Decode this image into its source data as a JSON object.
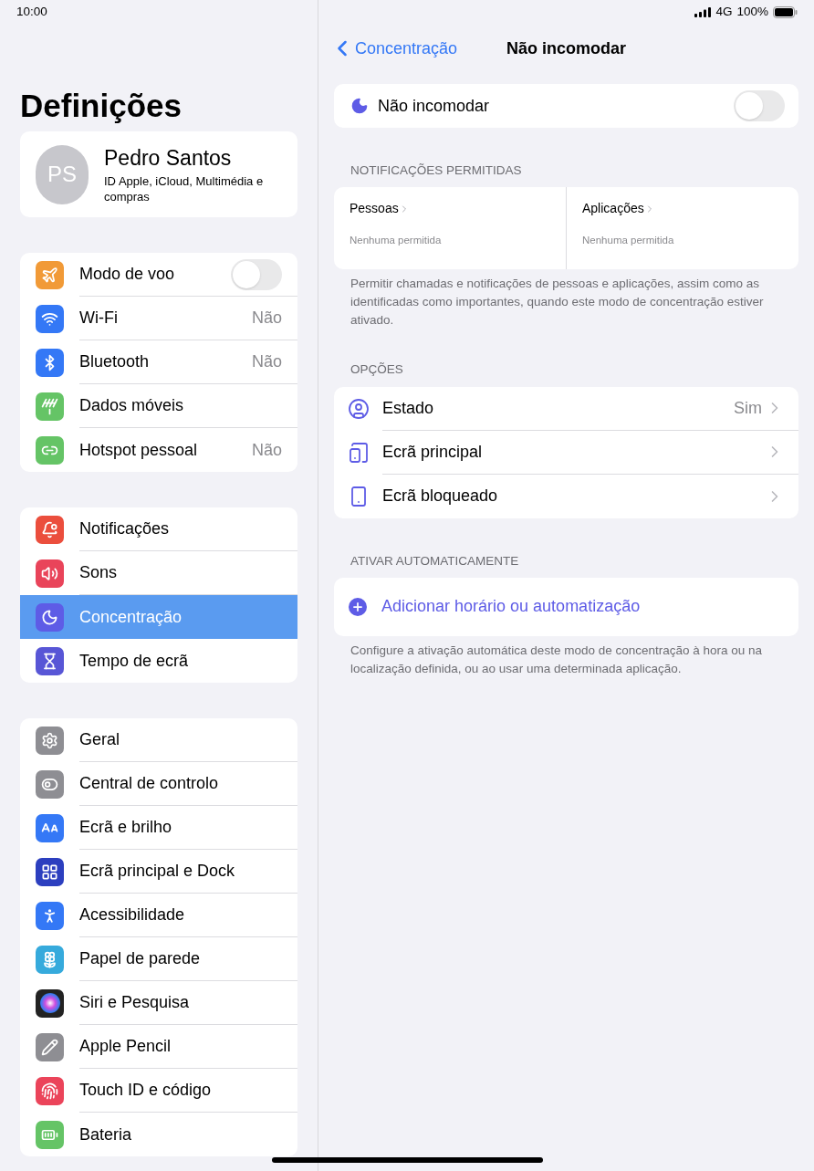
{
  "status_bar": {
    "time": "10:00",
    "network": "4G",
    "battery": "100%"
  },
  "sidebar": {
    "title": "Definições",
    "profile": {
      "initials": "PS",
      "name": "Pedro Santos",
      "subtitle": "ID Apple, iCloud, Multimédia e compras"
    },
    "groups": [
      [
        {
          "label": "Modo de voo",
          "kind": "toggle",
          "on": false,
          "selected": false
        },
        {
          "label": "Wi-Fi",
          "value": "Não",
          "kind": "value",
          "selected": false
        },
        {
          "label": "Bluetooth",
          "value": "Não",
          "kind": "value",
          "selected": false
        },
        {
          "label": "Dados móveis",
          "kind": "plain",
          "selected": false
        },
        {
          "label": "Hotspot pessoal",
          "value": "Não",
          "kind": "value",
          "selected": false
        }
      ],
      [
        {
          "label": "Notificações",
          "kind": "plain",
          "selected": false
        },
        {
          "label": "Sons",
          "kind": "plain",
          "selected": false
        },
        {
          "label": "Concentração",
          "kind": "plain",
          "selected": true
        },
        {
          "label": "Tempo de ecrã",
          "kind": "plain",
          "selected": false
        }
      ],
      [
        {
          "label": "Geral",
          "kind": "plain",
          "selected": false
        },
        {
          "label": "Central de controlo",
          "kind": "plain",
          "selected": false
        },
        {
          "label": "Ecrã e brilho",
          "kind": "plain",
          "selected": false
        },
        {
          "label": "Ecrã principal e Dock",
          "kind": "plain",
          "selected": false
        },
        {
          "label": "Acessibilidade",
          "kind": "plain",
          "selected": false
        },
        {
          "label": "Papel de parede",
          "kind": "plain",
          "selected": false
        },
        {
          "label": "Siri e Pesquisa",
          "kind": "plain",
          "selected": false
        },
        {
          "label": "Apple Pencil",
          "kind": "plain",
          "selected": false
        },
        {
          "label": "Touch ID e código",
          "kind": "plain",
          "selected": false
        },
        {
          "label": "Bateria",
          "kind": "plain",
          "selected": false
        }
      ]
    ]
  },
  "detail": {
    "back": "Concentração",
    "title": "Não incomodar",
    "focus_toggle": {
      "label": "Não incomodar",
      "on": false
    },
    "allowed": {
      "header": "NOTIFICAÇÕES PERMITIDAS",
      "columns": [
        {
          "title": "Pessoas",
          "value": "Nenhuma permitida"
        },
        {
          "title": "Aplicações",
          "value": "Nenhuma permitida"
        }
      ],
      "footer": "Permitir chamadas e notificações de pessoas e aplicações, assim como as identificadas como importantes, quando este modo de concentração estiver ativado."
    },
    "options": {
      "header": "OPÇÕES",
      "rows": [
        {
          "label": "Estado",
          "value": "Sim"
        },
        {
          "label": "Ecrã principal"
        },
        {
          "label": "Ecrã bloqueado"
        }
      ]
    },
    "automation": {
      "header": "ATIVAR AUTOMATICAMENTE",
      "action": "Adicionar horário ou automatização",
      "footer": "Configure a ativação automática deste modo de concentração à hora ou na localização definida, ou ao usar uma determinada aplicação."
    }
  }
}
